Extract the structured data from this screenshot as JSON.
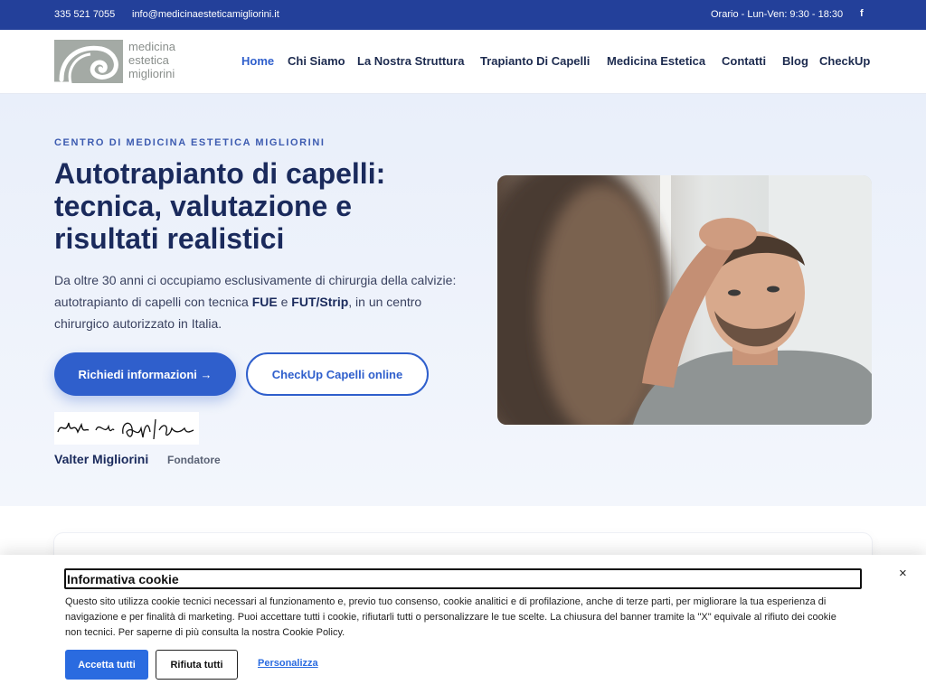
{
  "topbar": {
    "phone": "335 521 7055",
    "email": "info@medicinaesteticamigliorini.it",
    "hours": "Orario - Lun-Ven: 9:30 - 18:30",
    "facebook_glyph": "f",
    "background": "#23409a"
  },
  "logo": {
    "line1": "medicina",
    "line2": "estetica",
    "line3": "migliorini"
  },
  "nav": {
    "items": [
      {
        "label": "Home",
        "active": true
      },
      {
        "label": "Chi Siamo"
      },
      {
        "label": "La Nostra Struttura"
      },
      {
        "label": "Trapianto Di Capelli"
      },
      {
        "label": "Medicina Estetica"
      },
      {
        "label": "Contatti"
      },
      {
        "label": "Blog"
      },
      {
        "label": "CheckUp"
      }
    ]
  },
  "hero": {
    "eyebrow": "CENTRO DI MEDICINA ESTETICA MIGLIORINI",
    "title_line1": "Autotrapianto di capelli:",
    "title_line2": "tecnica, valutazione e",
    "title_line3": "risultati realistici",
    "lead_1": "Da oltre 30 anni ci occupiamo esclusivamente di chirurgia della calvizie: autotrapianto di capelli con tecnica ",
    "lead_fue": "FUE",
    "lead_2": " e ",
    "lead_fut": "FUT/Strip",
    "lead_3": ", in un centro chirurgico autorizzato in Italia.",
    "cta_primary": "Richiedi informazioni →",
    "cta_secondary": "CheckUp Capelli online",
    "founder_name": "Valter Migliorini",
    "founder_role": "Fondatore",
    "accent": "#2f5fcc"
  },
  "cookie": {
    "title": "Informativa cookie",
    "close_glyph": "×",
    "text": "Questo sito utilizza cookie tecnici necessari al funzionamento e, previo tuo consenso, cookie analitici e di profilazione, anche di terze parti, per migliorare la tua esperienza di navigazione e per finalità di marketing. Puoi accettare tutti i cookie, rifiutarli tutti o personalizzare le tue scelte. La chiusura del banner tramite la \"X\" equivale al rifiuto dei cookie non tecnici. Per saperne di più consulta la nostra Cookie Policy.",
    "accept": "Accetta tutti",
    "reject": "Rifiuta tutti",
    "customize": "Personalizza",
    "accent": "#2a6be0"
  }
}
